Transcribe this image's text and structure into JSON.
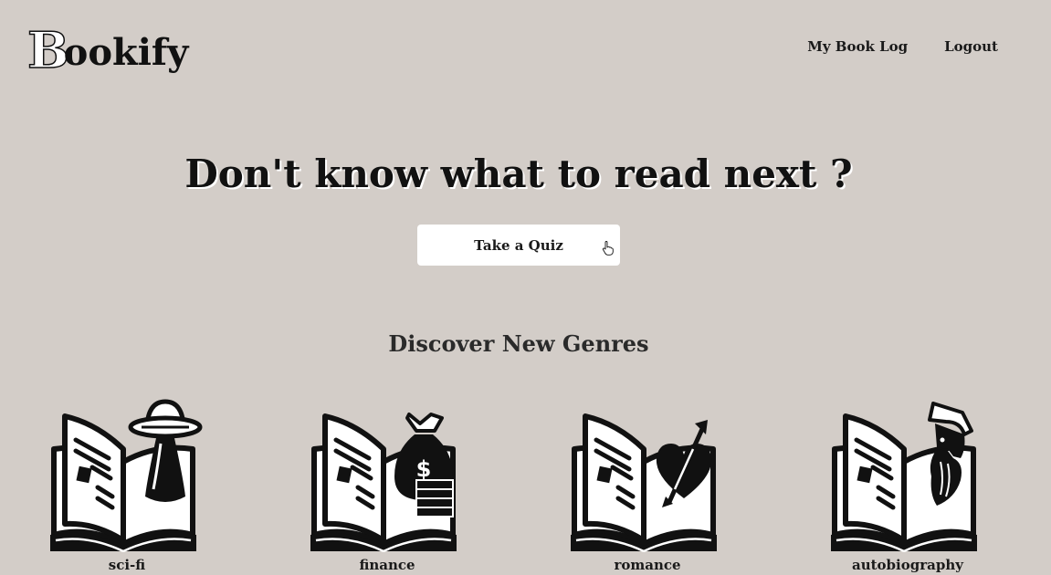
{
  "brand": {
    "logo_initial": "B",
    "logo_rest": "ookify"
  },
  "nav": {
    "book_log": "My Book Log",
    "logout": "Logout"
  },
  "hero": {
    "title": "Don't know what to read next ?",
    "quiz_button": "Take a Quiz"
  },
  "genres_section": {
    "title": "Discover New Genres",
    "items": [
      {
        "label": "sci-fi",
        "icon": "book-ufo-icon"
      },
      {
        "label": "finance",
        "icon": "book-money-bag-icon"
      },
      {
        "label": "romance",
        "icon": "book-heart-arrow-icon"
      },
      {
        "label": "autobiography",
        "icon": "book-bearded-man-icon"
      }
    ]
  },
  "colors": {
    "background": "#d3cdc8",
    "text": "#111111",
    "button": "#ffffff"
  }
}
